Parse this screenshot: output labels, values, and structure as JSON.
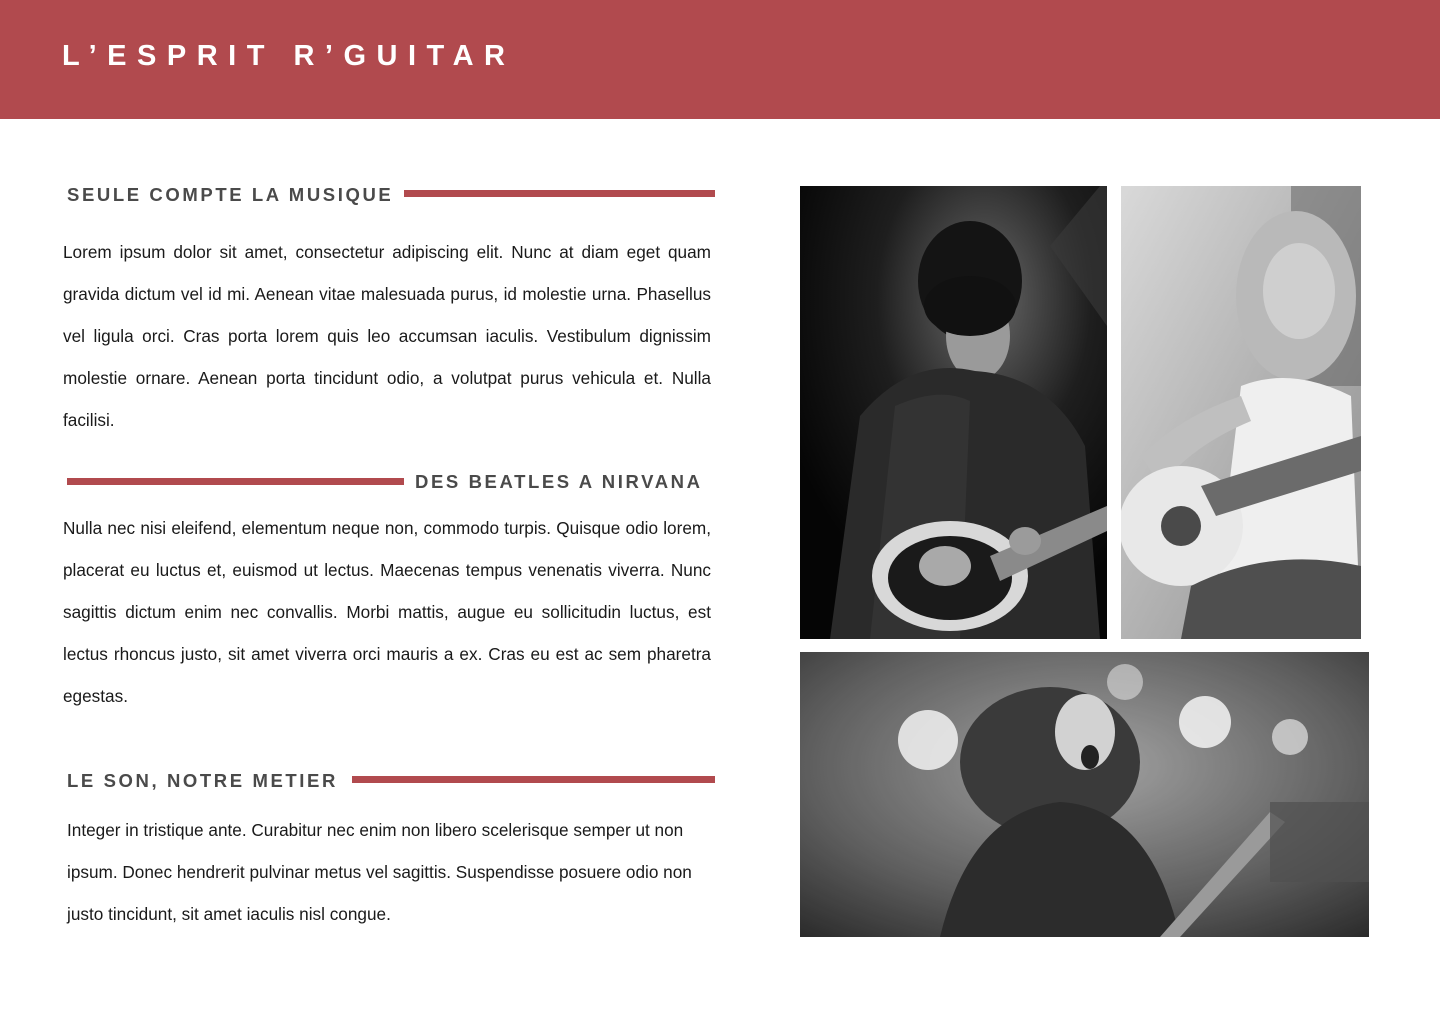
{
  "header": {
    "brand": "L’ESPRIT R’GUITAR",
    "color": "#b14a4e"
  },
  "sections": [
    {
      "title": "SEULE COMPTE LA MUSIQUE",
      "text": "Lorem ipsum dolor sit amet, consectetur adipiscing elit. Nunc at diam eget quam gravida dictum vel id mi. Aenean vitae malesuada purus, id molestie urna. Phasellus vel ligula orci. Cras porta lorem quis leo accumsan iaculis. Vestibulum dignissim molestie ornare. Aenean porta tincidunt odio, a volutpat purus vehicula et. Nulla facilisi."
    },
    {
      "title": "DES BEATLES A NIRVANA",
      "text": "Nulla nec nisi eleifend, elementum neque non, commodo turpis. Quisque odio lorem, placerat eu luctus et, euismod ut lectus. Maecenas tempus venenatis viverra. Nunc sagittis dictum enim nec convallis. Morbi mattis, augue eu sollicitudin luctus, est lectus rhoncus justo, sit amet viverra orci mauris a ex. Cras eu est ac sem pharetra egestas."
    },
    {
      "title": "LE SON, NOTRE METIER",
      "text": "Integer in tristique ante. Curabitur nec enim non libero scelerisque semper ut non ipsum. Donec hendrerit pulvinar metus vel sagittis. Suspendisse posuere odio non justo tincidunt, sit amet iaculis nisl congue."
    }
  ],
  "photos": [
    {
      "name": "male-guitarist-photo",
      "tone": "dark"
    },
    {
      "name": "female-guitarist-photo",
      "tone": "light"
    },
    {
      "name": "rock-singer-photo",
      "tone": "stage"
    }
  ]
}
